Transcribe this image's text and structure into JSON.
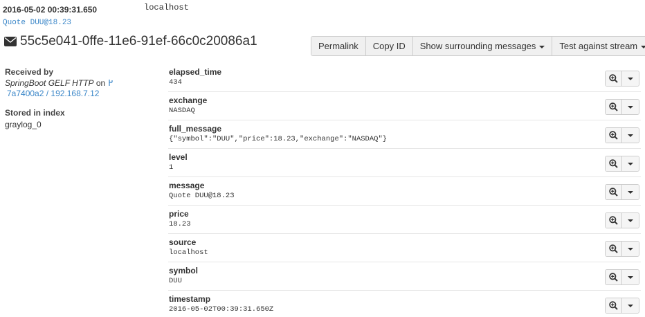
{
  "header": {
    "timestamp": "2016-05-02 00:39:31.650",
    "source": "localhost",
    "message_link": "Quote DUU@18.23",
    "message_id": "55c5e041-0ffe-11e6-91ef-66c0c20086a1"
  },
  "actions": {
    "permalink": "Permalink",
    "copy_id": "Copy ID",
    "surrounding": "Show surrounding messages",
    "test_stream": "Test against stream"
  },
  "meta": {
    "received_label": "Received by",
    "input_name": "SpringBoot GELF HTTP",
    "on_text": "on",
    "node": "7a7400a2 / 192.168.7.12",
    "stored_label": "Stored in index",
    "index": "graylog_0"
  },
  "fields": [
    {
      "name": "elapsed_time",
      "value": "434"
    },
    {
      "name": "exchange",
      "value": "NASDAQ"
    },
    {
      "name": "full_message",
      "value": "{\"symbol\":\"DUU\",\"price\":18.23,\"exchange\":\"NASDAQ\"}"
    },
    {
      "name": "level",
      "value": "1"
    },
    {
      "name": "message",
      "value": "Quote DUU@18.23"
    },
    {
      "name": "price",
      "value": "18.23"
    },
    {
      "name": "source",
      "value": "localhost"
    },
    {
      "name": "symbol",
      "value": "DUU"
    },
    {
      "name": "timestamp",
      "value": "2016-05-02T00:39:31.650Z"
    }
  ],
  "colors": {
    "link": "#3a86c8",
    "button_bg": "#f0f0f0"
  }
}
